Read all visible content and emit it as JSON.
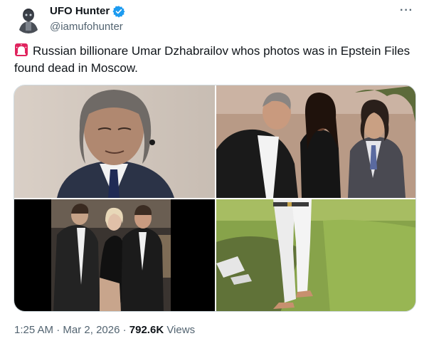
{
  "author": {
    "display_name": "UFO Hunter",
    "handle": "@iamufohunter",
    "verified": true
  },
  "more_menu": "···",
  "post": {
    "text": "Russian billionare Umar Dzhabrailov whos photos was in Epstein Files found dead in Moscow.",
    "leading_emoji": "siren-icon"
  },
  "media": {
    "count": 4
  },
  "meta": {
    "time": "1:25 AM",
    "separator": "·",
    "date": "Mar 2, 2026",
    "views_count": "792.6K",
    "views_label": "Views"
  },
  "colors": {
    "accent": "#1d9bf0",
    "text_primary": "#0f1419",
    "text_secondary": "#536471",
    "border": "#cfd9de"
  }
}
